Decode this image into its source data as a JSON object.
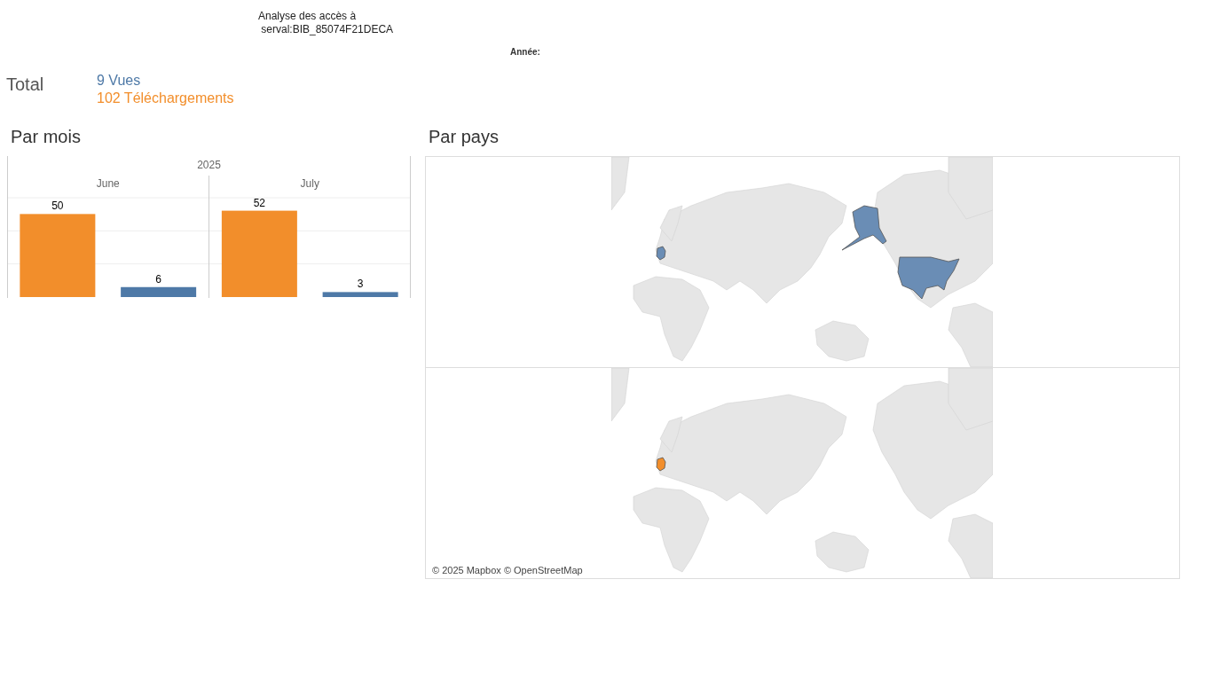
{
  "title": {
    "line1": "Analyse des accès à",
    "line2": "serval:BIB_85074F21DECA"
  },
  "filter": {
    "label": "Année:"
  },
  "total": {
    "label": "Total",
    "views": "9 Vues",
    "downloads": "102 Téléchargements"
  },
  "monthly": {
    "heading": "Par mois",
    "year": "2025",
    "chart_data": {
      "type": "bar",
      "categories": [
        "June",
        "July"
      ],
      "data_labels": true,
      "series": [
        {
          "color": "#f28e2b",
          "values": [
            50,
            52
          ]
        },
        {
          "color": "#4e79a7",
          "values": [
            6,
            3
          ]
        }
      ]
    }
  },
  "countries": {
    "heading": "Par pays",
    "attribution": "© 2025 Mapbox © OpenStreetMap",
    "maps": [
      {
        "kind": "views",
        "color": "#6a8db5"
      },
      {
        "kind": "downloads",
        "color": "#f28e2b"
      }
    ]
  }
}
